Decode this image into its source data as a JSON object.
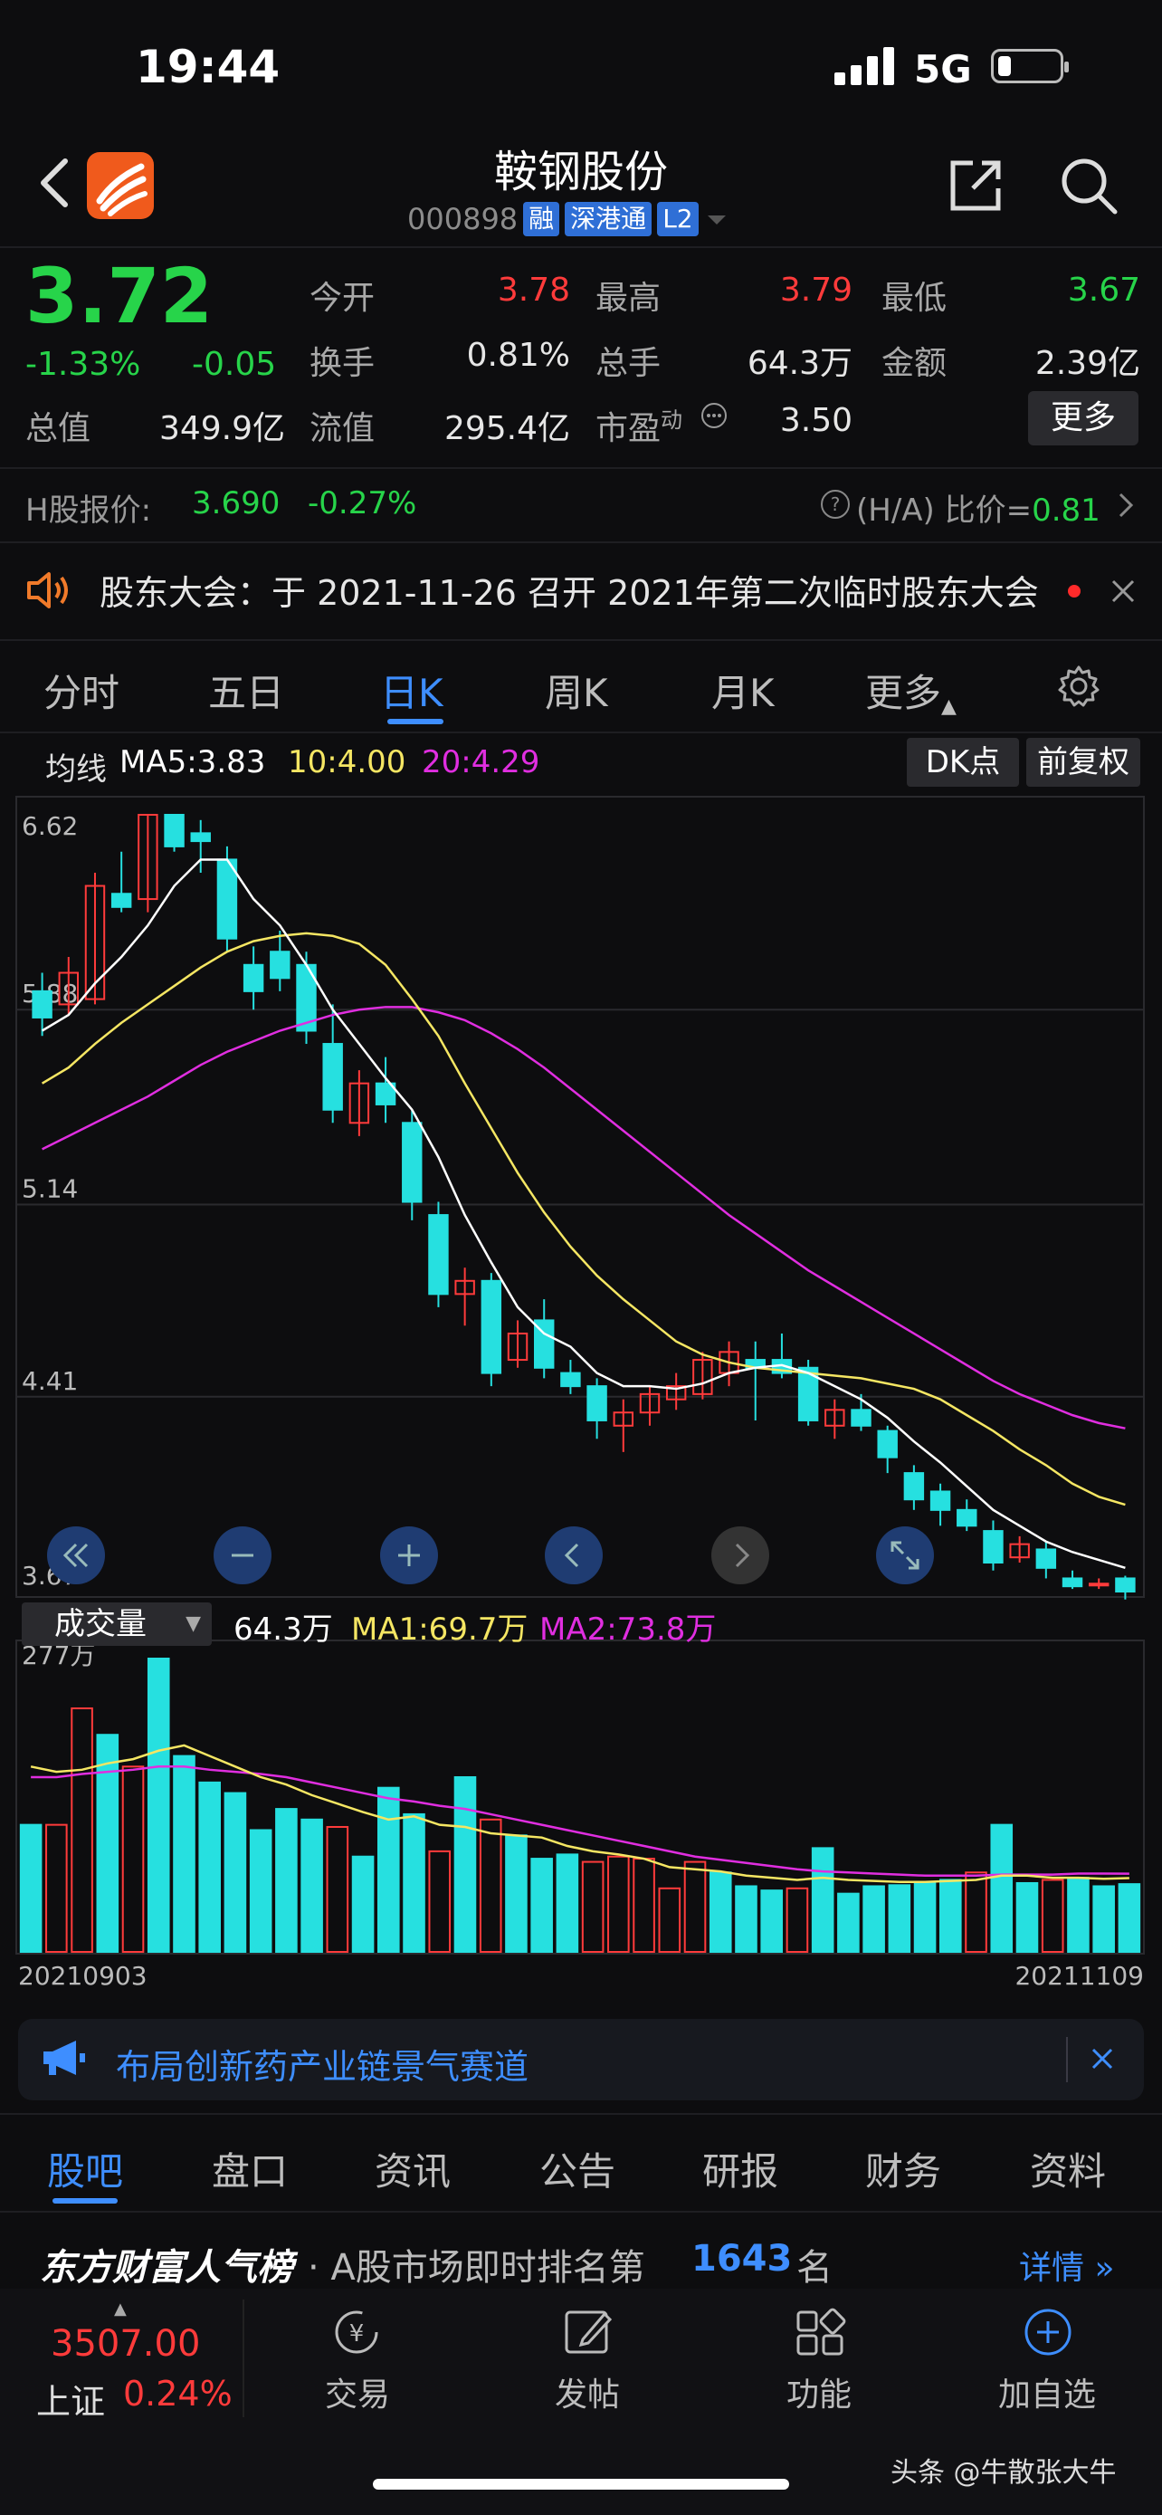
{
  "status": {
    "time": "19:44",
    "network": "5G"
  },
  "header": {
    "name": "鞍钢股份",
    "code": "000898",
    "tags": [
      "融",
      "深港通",
      "L2"
    ]
  },
  "quote": {
    "price": "3.72",
    "change_pct": "-1.33%",
    "change_amt": "-0.05",
    "open_label": "今开",
    "open": "3.78",
    "high_label": "最高",
    "high": "3.79",
    "low_label": "最低",
    "low": "3.67",
    "turnover_label": "换手",
    "turnover": "0.81%",
    "volume_label": "总手",
    "volume": "64.3万",
    "amount_label": "金额",
    "amount": "2.39亿",
    "mcap_label": "总值",
    "mcap": "349.9亿",
    "float_label": "流值",
    "float": "295.4亿",
    "pe_label": "市盈",
    "pe_sup": "动",
    "pe": "3.50",
    "more": "更多"
  },
  "hshare": {
    "label": "H股报价:",
    "price": "3.690",
    "pct": "-0.27%",
    "ratio_label": "(H/A) 比价=",
    "ratio": "0.81"
  },
  "notice": {
    "text": "股东大会：于 2021-11-26 召开 2021年第二次临时股东大会"
  },
  "tabs": [
    "分时",
    "五日",
    "日K",
    "周K",
    "月K",
    "更多"
  ],
  "ma": {
    "label": "均线",
    "ma5": "MA5:3.83",
    "ma10": "10:4.00",
    "ma20": "20:4.29"
  },
  "chart_buttons": {
    "dk": "DK点",
    "adjust": "前复权"
  },
  "volume": {
    "selector": "成交量",
    "value": "64.3万",
    "ma1": "MA1:69.7万",
    "ma2": "MA2:73.8万"
  },
  "ad": {
    "text": "布局创新药产业链景气赛道"
  },
  "bottom_tabs": [
    "股吧",
    "盘口",
    "资讯",
    "公告",
    "研报",
    "财务",
    "资料"
  ],
  "rank": {
    "brand": "东方财富人气榜",
    "text_prefix": "· A股市场即时排名第",
    "rank": "1643",
    "suffix": "名",
    "detail": "详情"
  },
  "bottom_nav": {
    "index_value": "3507.00",
    "index_name": "上证",
    "index_pct": "0.24%",
    "trade": "交易",
    "post": "发帖",
    "func": "功能",
    "watch": "加自选"
  },
  "watermark": "头条 @牛散张大牛",
  "colors": {
    "up": "#ff3b3b",
    "down": "#26e0e0",
    "accent": "#3e8eff",
    "ma5": "#ffffff",
    "ma10": "#f5e663",
    "ma20": "#e02ee0"
  },
  "chart_data": {
    "type": "candlestick",
    "y_ticks": [
      "6.62",
      "5.88",
      "5.14",
      "4.41",
      "3.67"
    ],
    "ylim": [
      3.67,
      6.62
    ],
    "x_start": "20210903",
    "x_end": "20211109",
    "candles": [
      {
        "o": 5.95,
        "h": 6.02,
        "l": 5.78,
        "c": 5.85
      },
      {
        "o": 5.9,
        "h": 6.08,
        "l": 5.86,
        "c": 6.02
      },
      {
        "o": 5.92,
        "h": 6.4,
        "l": 5.9,
        "c": 6.35
      },
      {
        "o": 6.32,
        "h": 6.48,
        "l": 6.25,
        "c": 6.27
      },
      {
        "o": 6.3,
        "h": 6.62,
        "l": 6.25,
        "c": 6.62
      },
      {
        "o": 6.62,
        "h": 6.62,
        "l": 6.48,
        "c": 6.5
      },
      {
        "o": 6.55,
        "h": 6.6,
        "l": 6.4,
        "c": 6.52
      },
      {
        "o": 6.45,
        "h": 6.5,
        "l": 6.1,
        "c": 6.15
      },
      {
        "o": 6.05,
        "h": 6.12,
        "l": 5.88,
        "c": 5.95
      },
      {
        "o": 6.1,
        "h": 6.18,
        "l": 5.95,
        "c": 6.0
      },
      {
        "o": 6.05,
        "h": 6.1,
        "l": 5.75,
        "c": 5.8
      },
      {
        "o": 5.75,
        "h": 5.9,
        "l": 5.45,
        "c": 5.5
      },
      {
        "o": 5.45,
        "h": 5.65,
        "l": 5.4,
        "c": 5.6
      },
      {
        "o": 5.6,
        "h": 5.7,
        "l": 5.45,
        "c": 5.52
      },
      {
        "o": 5.45,
        "h": 5.5,
        "l": 5.08,
        "c": 5.15
      },
      {
        "o": 5.1,
        "h": 5.15,
        "l": 4.75,
        "c": 4.8
      },
      {
        "o": 4.8,
        "h": 4.9,
        "l": 4.68,
        "c": 4.85
      },
      {
        "o": 4.85,
        "h": 4.88,
        "l": 4.45,
        "c": 4.5
      },
      {
        "o": 4.55,
        "h": 4.7,
        "l": 4.52,
        "c": 4.65
      },
      {
        "o": 4.7,
        "h": 4.78,
        "l": 4.48,
        "c": 4.52
      },
      {
        "o": 4.5,
        "h": 4.55,
        "l": 4.42,
        "c": 4.45
      },
      {
        "o": 4.45,
        "h": 4.48,
        "l": 4.25,
        "c": 4.32
      },
      {
        "o": 4.3,
        "h": 4.4,
        "l": 4.2,
        "c": 4.35
      },
      {
        "o": 4.35,
        "h": 4.45,
        "l": 4.3,
        "c": 4.42
      },
      {
        "o": 4.4,
        "h": 4.5,
        "l": 4.36,
        "c": 4.45
      },
      {
        "o": 4.42,
        "h": 4.58,
        "l": 4.4,
        "c": 4.55
      },
      {
        "o": 4.5,
        "h": 4.62,
        "l": 4.45,
        "c": 4.58
      },
      {
        "o": 4.55,
        "h": 4.62,
        "l": 4.32,
        "c": 4.52
      },
      {
        "o": 4.55,
        "h": 4.65,
        "l": 4.48,
        "c": 4.5
      },
      {
        "o": 4.52,
        "h": 4.55,
        "l": 4.3,
        "c": 4.32
      },
      {
        "o": 4.3,
        "h": 4.4,
        "l": 4.25,
        "c": 4.36
      },
      {
        "o": 4.36,
        "h": 4.42,
        "l": 4.28,
        "c": 4.3
      },
      {
        "o": 4.28,
        "h": 4.3,
        "l": 4.12,
        "c": 4.18
      },
      {
        "o": 4.12,
        "h": 4.15,
        "l": 3.98,
        "c": 4.02
      },
      {
        "o": 4.05,
        "h": 4.08,
        "l": 3.92,
        "c": 3.98
      },
      {
        "o": 3.98,
        "h": 4.02,
        "l": 3.9,
        "c": 3.92
      },
      {
        "o": 3.9,
        "h": 3.94,
        "l": 3.75,
        "c": 3.78
      },
      {
        "o": 3.8,
        "h": 3.88,
        "l": 3.78,
        "c": 3.85
      },
      {
        "o": 3.83,
        "h": 3.86,
        "l": 3.72,
        "c": 3.76
      },
      {
        "o": 3.72,
        "h": 3.75,
        "l": 3.68,
        "c": 3.69
      },
      {
        "o": 3.7,
        "h": 3.72,
        "l": 3.68,
        "c": 3.7
      },
      {
        "o": 3.72,
        "h": 3.73,
        "l": 3.64,
        "c": 3.67
      }
    ],
    "ma5": [
      5.8,
      5.86,
      5.98,
      6.08,
      6.2,
      6.35,
      6.45,
      6.45,
      6.3,
      6.2,
      6.05,
      5.88,
      5.75,
      5.62,
      5.5,
      5.32,
      5.1,
      4.92,
      4.75,
      4.65,
      4.6,
      4.5,
      4.45,
      4.45,
      4.44,
      4.46,
      4.5,
      4.52,
      4.53,
      4.5,
      4.45,
      4.4,
      4.33,
      4.24,
      4.16,
      4.07,
      3.98,
      3.92,
      3.86,
      3.82,
      3.79,
      3.76
    ],
    "ma10": [
      5.6,
      5.66,
      5.75,
      5.83,
      5.9,
      5.97,
      6.04,
      6.1,
      6.14,
      6.16,
      6.17,
      6.16,
      6.13,
      6.05,
      5.92,
      5.78,
      5.6,
      5.43,
      5.26,
      5.11,
      4.98,
      4.87,
      4.78,
      4.7,
      4.62,
      4.57,
      4.54,
      4.52,
      4.51,
      4.5,
      4.49,
      4.48,
      4.46,
      4.44,
      4.4,
      4.34,
      4.28,
      4.21,
      4.15,
      4.08,
      4.03,
      4.0
    ],
    "ma20": [
      5.35,
      5.4,
      5.45,
      5.5,
      5.55,
      5.61,
      5.67,
      5.72,
      5.76,
      5.8,
      5.83,
      5.86,
      5.88,
      5.89,
      5.89,
      5.87,
      5.84,
      5.79,
      5.73,
      5.66,
      5.58,
      5.5,
      5.42,
      5.34,
      5.26,
      5.18,
      5.1,
      5.03,
      4.96,
      4.89,
      4.83,
      4.77,
      4.71,
      4.65,
      4.59,
      4.53,
      4.47,
      4.42,
      4.38,
      4.34,
      4.31,
      4.29
    ],
    "volume_scale_max_label": "277万",
    "volume_max": 277,
    "volumes": [
      120,
      120,
      230,
      205,
      175,
      277,
      185,
      160,
      150,
      115,
      135,
      125,
      118,
      90,
      155,
      130,
      95,
      165,
      125,
      110,
      88,
      92,
      85,
      90,
      88,
      60,
      85,
      75,
      62,
      58,
      60,
      98,
      55,
      62,
      63,
      65,
      68,
      75,
      120,
      65,
      68,
      70,
      62,
      64
    ],
    "vol_ma1": [
      175,
      170,
      172,
      178,
      182,
      190,
      195,
      185,
      175,
      165,
      158,
      148,
      140,
      132,
      125,
      128,
      120,
      118,
      112,
      110,
      108,
      100,
      95,
      92,
      88,
      80,
      78,
      76,
      72,
      70,
      68,
      70,
      68,
      67,
      66,
      66,
      67,
      68,
      72,
      72,
      70,
      70,
      69,
      69.7
    ],
    "vol_ma2": [
      165,
      165,
      168,
      170,
      172,
      175,
      175,
      172,
      170,
      168,
      165,
      160,
      155,
      150,
      145,
      142,
      138,
      135,
      130,
      125,
      120,
      115,
      110,
      105,
      100,
      95,
      90,
      87,
      84,
      81,
      78,
      76,
      75,
      74,
      73,
      72,
      72,
      72,
      73,
      73,
      73,
      74,
      74,
      73.8
    ]
  }
}
